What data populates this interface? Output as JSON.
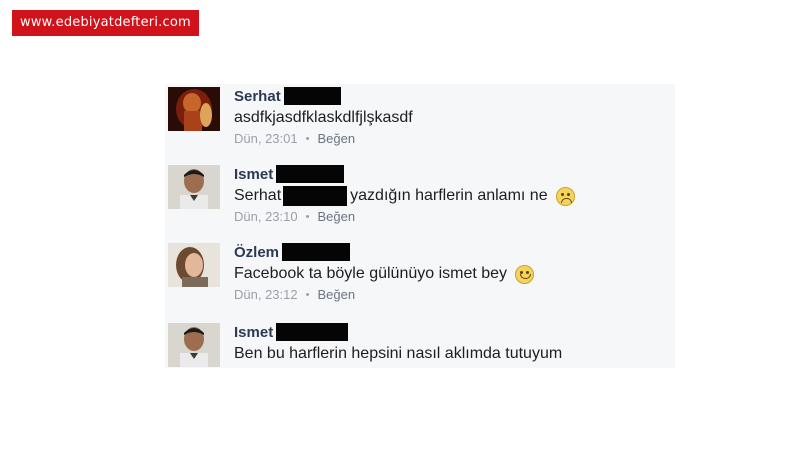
{
  "watermark": {
    "text": "www.edebiyatdefteri.com",
    "color": "#d0121b"
  },
  "comments": [
    {
      "name": "Serhat",
      "text": "asdfkjasdfklaskdlfjlşkasdf",
      "time": "Dün, 23:01",
      "like_label": "Beğen"
    },
    {
      "name": "Ismet",
      "text_before": "Serhat",
      "text_after": "yazdığın harflerin anlamı ne",
      "emoji": "sad-face-icon",
      "time": "Dün, 23:10",
      "like_label": "Beğen"
    },
    {
      "name": "Özlem",
      "text": "Facebook ta böyle gülünüyo ismet bey",
      "emoji": "smiley-face-icon",
      "time": "Dün, 23:12",
      "like_label": "Beğen"
    },
    {
      "name": "Ismet",
      "text": "Ben bu harflerin hepsini nasıl aklımda tutuyum"
    }
  ],
  "separator": "•",
  "colors": {
    "name": "#2d3a55",
    "meta": "#9aa0aa",
    "panel": "#f6f7f9",
    "redaction": "#050505"
  }
}
